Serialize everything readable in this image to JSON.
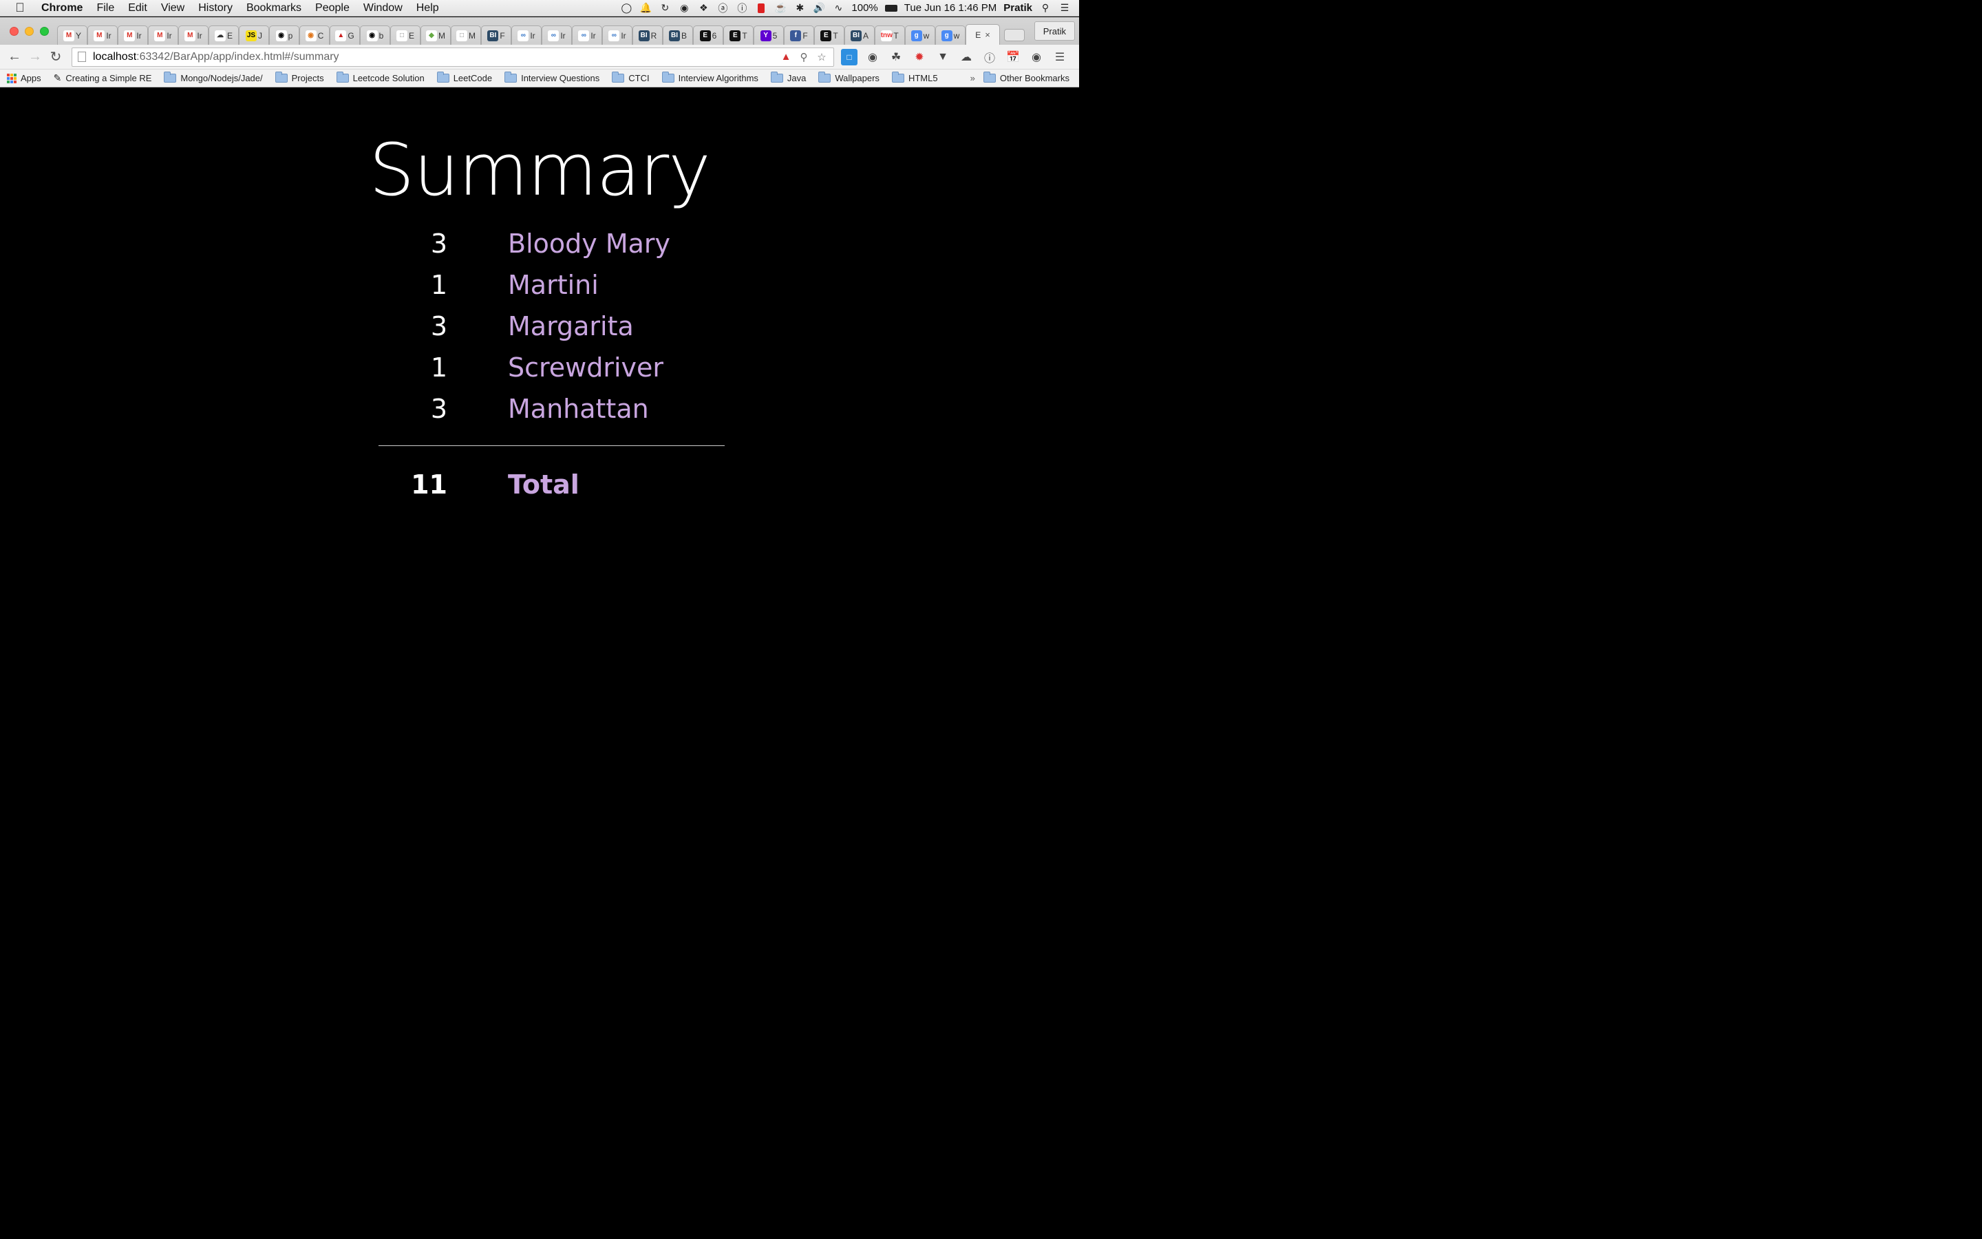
{
  "colors": {
    "accent_lavender": "#c9a6e0",
    "page_background": "#000000",
    "text_white": "#ffffff"
  },
  "menubar": {
    "app_name": "Chrome",
    "items": [
      "File",
      "Edit",
      "View",
      "History",
      "Bookmarks",
      "People",
      "Window",
      "Help"
    ],
    "battery": "100%",
    "datetime": "Tue Jun 16  1:46 PM",
    "user": "Pratik"
  },
  "tabs": [
    {
      "icon": "gmail-icon",
      "label": "Y"
    },
    {
      "icon": "gmail-icon",
      "label": "Ir"
    },
    {
      "icon": "gmail-icon",
      "label": "Ir"
    },
    {
      "icon": "gmail-icon",
      "label": "Ir"
    },
    {
      "icon": "gmail-icon",
      "label": "Ir"
    },
    {
      "icon": "cloud-icon",
      "label": "E"
    },
    {
      "icon": "js-icon",
      "label": "J"
    },
    {
      "icon": "github-icon",
      "label": "p"
    },
    {
      "icon": "palette-icon",
      "label": "C"
    },
    {
      "icon": "hat-icon",
      "label": "G"
    },
    {
      "icon": "github-icon",
      "label": "b"
    },
    {
      "icon": "page-icon",
      "label": "E"
    },
    {
      "icon": "shield-icon",
      "label": "M"
    },
    {
      "icon": "page-icon",
      "label": "M"
    },
    {
      "icon": "bi-icon",
      "label": "F"
    },
    {
      "icon": "infinity-icon",
      "label": "Ir"
    },
    {
      "icon": "infinity-icon",
      "label": "Ir"
    },
    {
      "icon": "infinity-icon",
      "label": "Ir"
    },
    {
      "icon": "infinity-icon",
      "label": "Ir"
    },
    {
      "icon": "bi-icon",
      "label": "R"
    },
    {
      "icon": "bi-icon",
      "label": "B"
    },
    {
      "icon": "e-icon",
      "label": "6"
    },
    {
      "icon": "e-icon",
      "label": "T"
    },
    {
      "icon": "yahoo-icon",
      "label": "5"
    },
    {
      "icon": "facebook-icon",
      "label": "F"
    },
    {
      "icon": "e-icon",
      "label": "T"
    },
    {
      "icon": "bi-icon",
      "label": "A"
    },
    {
      "icon": "tnw-icon",
      "label": "T"
    },
    {
      "icon": "google-icon",
      "label": "w"
    },
    {
      "icon": "google-icon",
      "label": "w"
    }
  ],
  "active_tab": {
    "label": "E",
    "close": "×"
  },
  "profile_button": "Pratik",
  "omnibox": {
    "host": "localhost",
    "rest": ":63342/BarApp/app/index.html#/summary"
  },
  "bookmarks": {
    "apps": "Apps",
    "items": [
      {
        "type": "page",
        "label": "Creating a Simple RE"
      },
      {
        "type": "folder",
        "label": "Mongo/Nodejs/Jade/"
      },
      {
        "type": "folder",
        "label": "Projects"
      },
      {
        "type": "folder",
        "label": "Leetcode Solution"
      },
      {
        "type": "folder",
        "label": "LeetCode"
      },
      {
        "type": "folder",
        "label": "Interview Questions"
      },
      {
        "type": "folder",
        "label": "CTCI"
      },
      {
        "type": "folder",
        "label": "Interview Algorithms"
      },
      {
        "type": "folder",
        "label": "Java"
      },
      {
        "type": "folder",
        "label": "Wallpapers"
      },
      {
        "type": "folder",
        "label": "HTML5"
      }
    ],
    "overflow": "»",
    "other": "Other Bookmarks"
  },
  "summary": {
    "title": "Summary",
    "items": [
      {
        "count": "3",
        "name": "Bloody Mary"
      },
      {
        "count": "1",
        "name": "Martini"
      },
      {
        "count": "3",
        "name": "Margarita"
      },
      {
        "count": "1",
        "name": "Screwdriver"
      },
      {
        "count": "3",
        "name": "Manhattan"
      }
    ],
    "total_count": "11",
    "total_label": "Total"
  }
}
